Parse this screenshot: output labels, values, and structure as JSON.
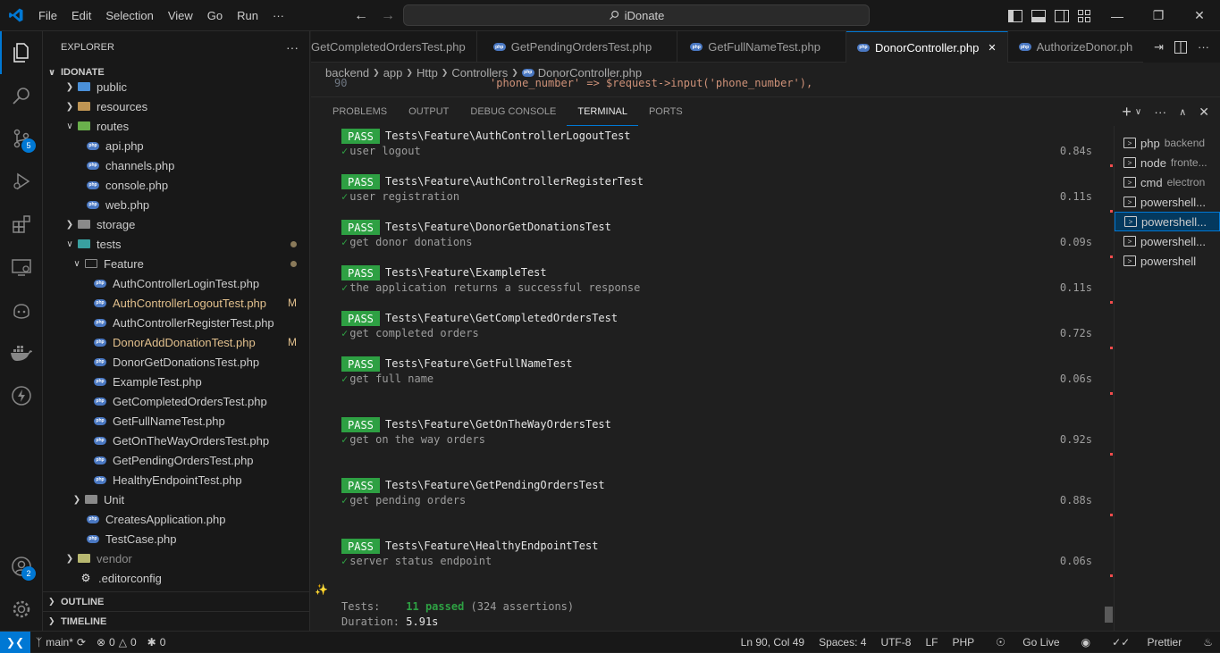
{
  "menu": [
    "File",
    "Edit",
    "Selection",
    "View",
    "Go",
    "Run",
    "···"
  ],
  "search": {
    "text": "iDonate"
  },
  "explorer": {
    "title": "EXPLORER",
    "root": "IDONATE",
    "items": [
      {
        "label": "public"
      },
      {
        "label": "resources"
      },
      {
        "label": "routes"
      },
      {
        "label": "api.php"
      },
      {
        "label": "channels.php"
      },
      {
        "label": "console.php"
      },
      {
        "label": "web.php"
      },
      {
        "label": "storage"
      },
      {
        "label": "tests"
      },
      {
        "label": "Feature"
      },
      {
        "label": "AuthControllerLoginTest.php"
      },
      {
        "label": "AuthControllerLogoutTest.php",
        "status": "M"
      },
      {
        "label": "AuthControllerRegisterTest.php"
      },
      {
        "label": "DonorAddDonationTest.php",
        "status": "M"
      },
      {
        "label": "DonorGetDonationsTest.php"
      },
      {
        "label": "ExampleTest.php"
      },
      {
        "label": "GetCompletedOrdersTest.php"
      },
      {
        "label": "GetFullNameTest.php"
      },
      {
        "label": "GetOnTheWayOrdersTest.php"
      },
      {
        "label": "GetPendingOrdersTest.php"
      },
      {
        "label": "HealthyEndpointTest.php"
      },
      {
        "label": "Unit"
      },
      {
        "label": "CreatesApplication.php"
      },
      {
        "label": "TestCase.php"
      },
      {
        "label": "vendor"
      },
      {
        "label": ".editorconfig"
      }
    ],
    "outline": "OUTLINE",
    "timeline": "TIMELINE"
  },
  "activity_badges": {
    "scm": "5",
    "accounts": "2"
  },
  "tabs": [
    {
      "label": "GetCompletedOrdersTest.php"
    },
    {
      "label": "GetPendingOrdersTest.php"
    },
    {
      "label": "GetFullNameTest.php"
    },
    {
      "label": "DonorController.php",
      "close": "✕"
    },
    {
      "label": "AuthorizeDonor.ph"
    }
  ],
  "breadcrumb": [
    "backend",
    "app",
    "Http",
    "Controllers",
    "DonorController.php"
  ],
  "code": {
    "line": "90",
    "text": "'phone_number' => $request->input('phone_number'),"
  },
  "panel_tabs": [
    "PROBLEMS",
    "OUTPUT",
    "DEBUG CONSOLE",
    "TERMINAL",
    "PORTS"
  ],
  "tests": [
    {
      "pass": "PASS",
      "name": "Tests\\Feature\\AuthControllerLogoutTest",
      "desc": "user logout",
      "time": "0.84s"
    },
    {
      "pass": "PASS",
      "name": "Tests\\Feature\\AuthControllerRegisterTest",
      "desc": "user registration",
      "time": "0.11s"
    },
    {
      "pass": "PASS",
      "name": "Tests\\Feature\\DonorGetDonationsTest",
      "desc": "get donor donations",
      "time": "0.09s"
    },
    {
      "pass": "PASS",
      "name": "Tests\\Feature\\ExampleTest",
      "desc": "the application returns a successful response",
      "time": "0.11s"
    },
    {
      "pass": "PASS",
      "name": "Tests\\Feature\\GetCompletedOrdersTest",
      "desc": "get completed orders",
      "time": "0.72s"
    },
    {
      "pass": "PASS",
      "name": "Tests\\Feature\\GetFullNameTest",
      "desc": "get full name",
      "time": "0.06s"
    },
    {
      "pass": "PASS",
      "name": "Tests\\Feature\\GetOnTheWayOrdersTest",
      "desc": "get on the way orders",
      "time": "0.92s"
    },
    {
      "pass": "PASS",
      "name": "Tests\\Feature\\GetPendingOrdersTest",
      "desc": "get pending orders",
      "time": "0.88s"
    },
    {
      "pass": "PASS",
      "name": "Tests\\Feature\\HealthyEndpointTest",
      "desc": "server status endpoint",
      "time": "0.06s"
    }
  ],
  "summary": {
    "tests_label": "Tests:",
    "passed": "11 passed",
    "assertions": "(324 assertions)",
    "duration_label": "Duration:",
    "duration": "5.91s"
  },
  "terminals": [
    {
      "name": "php",
      "sub": "backend"
    },
    {
      "name": "node",
      "sub": "fronte..."
    },
    {
      "name": "cmd",
      "sub": "electron"
    },
    {
      "name": "powershell...",
      "sub": ""
    },
    {
      "name": "powershell...",
      "sub": "",
      "selected": true
    },
    {
      "name": "powershell...",
      "sub": ""
    },
    {
      "name": "powershell",
      "sub": ""
    }
  ],
  "status": {
    "branch": "main*",
    "errors": "0",
    "warnings": "0",
    "ports": "0",
    "position": "Ln 90, Col 49",
    "spaces": "Spaces: 4",
    "encoding": "UTF-8",
    "eol": "LF",
    "language": "PHP",
    "golive": "Go Live",
    "prettier": "Prettier"
  },
  "colors": {
    "accent": "#0078d4",
    "pass": "#2ea043",
    "modified": "#e2c08d"
  }
}
